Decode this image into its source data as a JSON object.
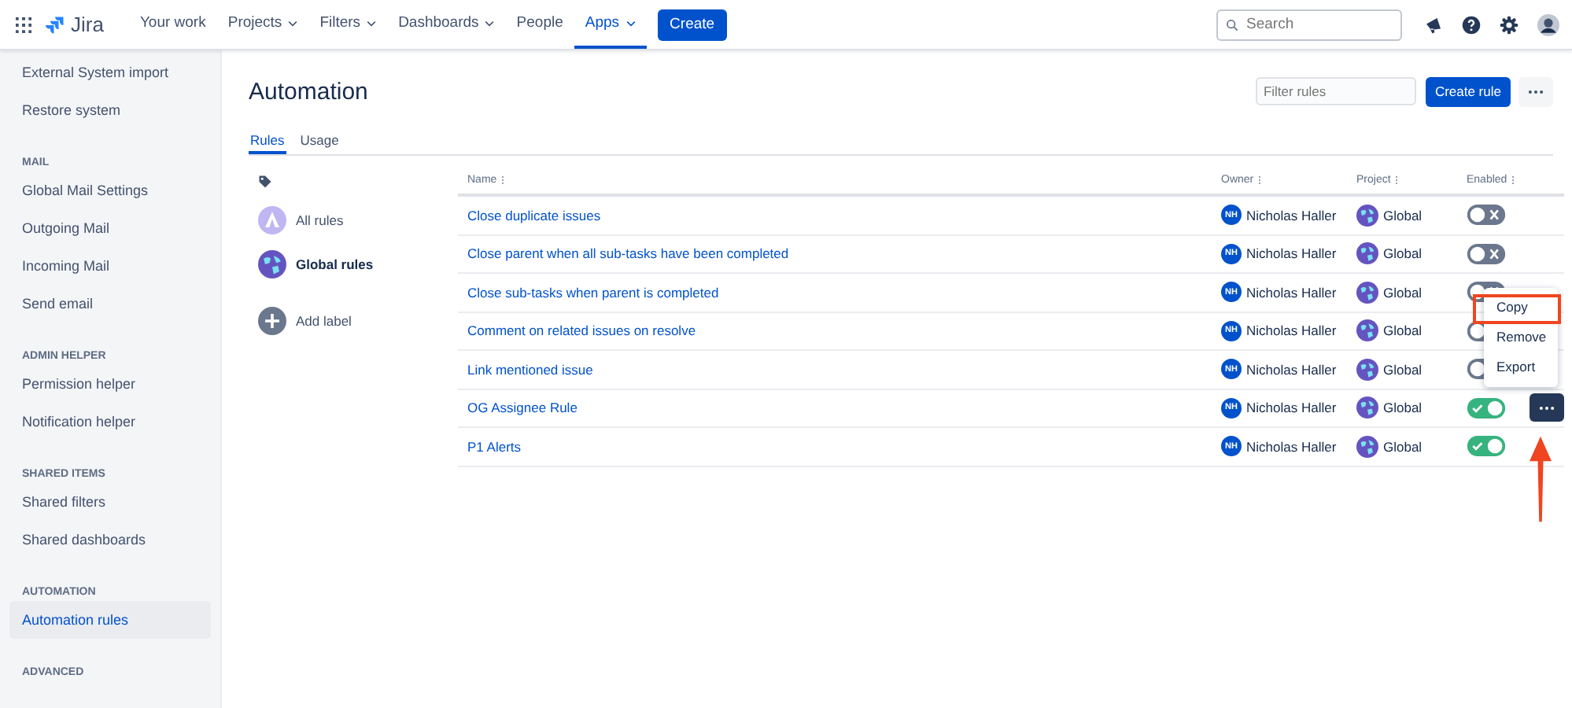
{
  "nav": {
    "product": "Jira",
    "items": [
      {
        "label": "Your work",
        "dropdown": false,
        "selected": false
      },
      {
        "label": "Projects",
        "dropdown": true,
        "selected": false
      },
      {
        "label": "Filters",
        "dropdown": true,
        "selected": false
      },
      {
        "label": "Dashboards",
        "dropdown": true,
        "selected": false
      },
      {
        "label": "People",
        "dropdown": false,
        "selected": false
      },
      {
        "label": "Apps",
        "dropdown": true,
        "selected": true
      }
    ],
    "create": "Create",
    "search": {
      "placeholder": "Search"
    }
  },
  "sidebar": [
    {
      "items": [
        {
          "label": "External System import",
          "selected": false
        },
        {
          "label": "Restore system",
          "selected": false
        }
      ]
    },
    {
      "heading": "MAIL",
      "items": [
        {
          "label": "Global Mail Settings",
          "selected": false
        },
        {
          "label": "Outgoing Mail",
          "selected": false
        },
        {
          "label": "Incoming Mail",
          "selected": false
        },
        {
          "label": "Send email",
          "selected": false
        }
      ]
    },
    {
      "heading": "ADMIN HELPER",
      "items": [
        {
          "label": "Permission helper",
          "selected": false
        },
        {
          "label": "Notification helper",
          "selected": false
        }
      ]
    },
    {
      "heading": "SHARED ITEMS",
      "items": [
        {
          "label": "Shared filters",
          "selected": false
        },
        {
          "label": "Shared dashboards",
          "selected": false
        }
      ]
    },
    {
      "heading": "AUTOMATION",
      "items": [
        {
          "label": "Automation rules",
          "selected": true
        }
      ]
    },
    {
      "heading": "ADVANCED"
    }
  ],
  "page": {
    "title": "Automation",
    "filter": {
      "placeholder": "Filter rules"
    },
    "create_button": "Create rule",
    "tabs": [
      {
        "label": "Rules",
        "selected": true
      },
      {
        "label": "Usage",
        "selected": false
      }
    ],
    "labels": [
      {
        "label": "All rules",
        "kind": "all",
        "selected": false
      },
      {
        "label": "Global rules",
        "kind": "global",
        "selected": true
      },
      {
        "label": "Add label",
        "kind": "add",
        "selected": false
      }
    ],
    "table": {
      "columns": [
        {
          "label": "Name"
        },
        {
          "label": "Owner"
        },
        {
          "label": "Project"
        },
        {
          "label": "Enabled"
        }
      ],
      "rows": [
        {
          "name": "Close duplicate issues",
          "initials": "NH",
          "owner": "Nicholas Haller",
          "project": "Global",
          "enabled": false,
          "actions_shown": false
        },
        {
          "name": "Close parent when all sub-tasks have been completed",
          "initials": "NH",
          "owner": "Nicholas Haller",
          "project": "Global",
          "enabled": false,
          "actions_shown": false
        },
        {
          "name": "Close sub-tasks when parent is completed",
          "initials": "NH",
          "owner": "Nicholas Haller",
          "project": "Global",
          "enabled": false,
          "actions_shown": false
        },
        {
          "name": "Comment on related issues on resolve",
          "initials": "NH",
          "owner": "Nicholas Haller",
          "project": "Global",
          "enabled": false,
          "actions_shown": false
        },
        {
          "name": "Link mentioned issue",
          "initials": "NH",
          "owner": "Nicholas Haller",
          "project": "Global",
          "enabled": false,
          "actions_shown": false
        },
        {
          "name": "OG Assignee Rule",
          "initials": "NH",
          "owner": "Nicholas Haller",
          "project": "Global",
          "enabled": true,
          "actions_shown": true
        },
        {
          "name": "P1 Alerts",
          "initials": "NH",
          "owner": "Nicholas Haller",
          "project": "Global",
          "enabled": true,
          "actions_shown": false
        }
      ]
    },
    "menu": [
      {
        "label": "Copy",
        "highlighted": true
      },
      {
        "label": "Remove",
        "highlighted": false
      },
      {
        "label": "Export",
        "highlighted": false
      }
    ]
  }
}
